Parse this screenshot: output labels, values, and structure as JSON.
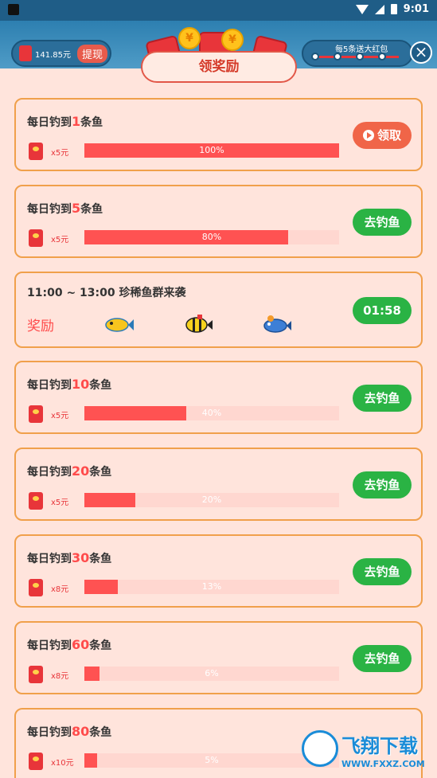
{
  "status_bar": {
    "time": "9:01"
  },
  "game": {
    "balance": "141.85元",
    "withdraw_label": "提现",
    "promo_text": "每5条送大红包"
  },
  "icons": {
    "close": "close-icon",
    "wifi": "wifi-icon",
    "signal": "signal-icon",
    "battery": "battery-icon"
  },
  "colors": {
    "accent": "#ff4b4b",
    "green": "#2ab344",
    "card_border": "#f0a04b",
    "panel_bg": "#ffe4dc"
  },
  "panel": {
    "title": "领奖励",
    "tasks": [
      {
        "prefix": "每日钓到",
        "count": "1",
        "suffix": "条鱼",
        "reward": "x5元",
        "progress": 1.0,
        "progress_label": "100%",
        "button": "领取"
      },
      {
        "prefix": "每日钓到",
        "count": "5",
        "suffix": "条鱼",
        "reward": "x5元",
        "progress": 0.8,
        "progress_label": "80%",
        "button": "去钓鱼"
      },
      {
        "prefix": "每日钓到",
        "count": "10",
        "suffix": "条鱼",
        "reward": "x5元",
        "progress": 0.4,
        "progress_label": "40%",
        "button": "去钓鱼"
      },
      {
        "prefix": "每日钓到",
        "count": "20",
        "suffix": "条鱼",
        "reward": "x5元",
        "progress": 0.2,
        "progress_label": "20%",
        "button": "去钓鱼"
      },
      {
        "prefix": "每日钓到",
        "count": "30",
        "suffix": "条鱼",
        "reward": "x8元",
        "progress": 0.13,
        "progress_label": "13%",
        "button": "去钓鱼"
      },
      {
        "prefix": "每日钓到",
        "count": "60",
        "suffix": "条鱼",
        "reward": "x8元",
        "progress": 0.06,
        "progress_label": "6%",
        "button": "去钓鱼"
      },
      {
        "prefix": "每日钓到",
        "count": "80",
        "suffix": "条鱼",
        "reward": "x10元",
        "progress": 0.05,
        "progress_label": "5%",
        "button": ""
      }
    ],
    "event": {
      "title": "11:00 ~ 13:00 珍稀鱼群来袭",
      "reward_label": "奖励",
      "countdown": "01:58",
      "fish_icons": [
        "fish-icon-yellow",
        "fish-icon-striped",
        "fish-icon-blue"
      ]
    }
  },
  "watermark": {
    "text": "飞翔下载",
    "url": "WWW.FXXZ.COM"
  }
}
